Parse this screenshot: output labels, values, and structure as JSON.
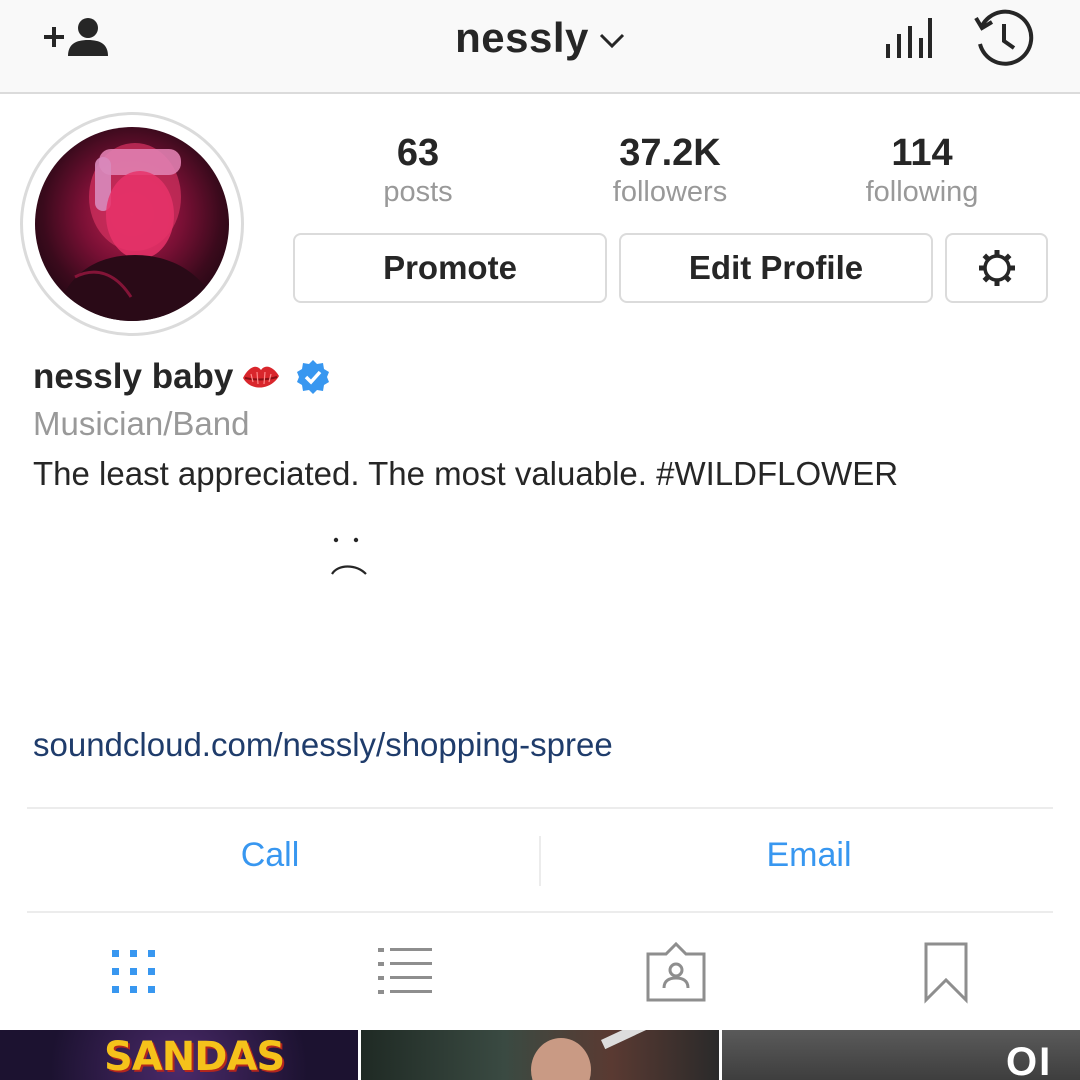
{
  "header": {
    "username": "nessly",
    "icons": {
      "left": "add-user-icon",
      "chevron": "chevron-down-icon",
      "insights": "insights-icon",
      "archive": "archive-icon"
    }
  },
  "profile": {
    "stats": [
      {
        "value": "63",
        "label": "posts"
      },
      {
        "value": "37.2K",
        "label": "followers"
      },
      {
        "value": "114",
        "label": "following"
      }
    ],
    "buttons": {
      "promote": "Promote",
      "edit_profile": "Edit Profile",
      "settings_icon": "gear-icon"
    },
    "display_name": "nessly baby",
    "category": "Musician/Band",
    "bio": "The least appreciated. The most valuable. #WILDFLOWER",
    "link": "soundcloud.com/nessly/shopping-spree"
  },
  "contact": {
    "call": "Call",
    "email": "Email"
  },
  "tabs": [
    {
      "icon": "grid-icon",
      "active": true
    },
    {
      "icon": "list-icon",
      "active": false
    },
    {
      "icon": "tagged-icon",
      "active": false
    },
    {
      "icon": "bookmark-icon",
      "active": false
    }
  ],
  "grid_preview": {
    "thumb1_text": "SANDAS",
    "thumb3_text": "OI"
  },
  "colors": {
    "link_blue": "#3897f0",
    "bio_link": "#1f3c6b",
    "muted": "#999999",
    "text": "#262626",
    "verified": "#3897f0"
  }
}
